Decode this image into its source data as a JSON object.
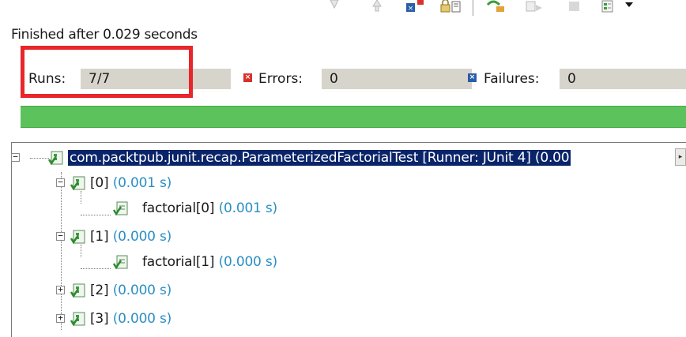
{
  "toolbar": {
    "icons": [
      "next-failure-icon",
      "previous-failure-icon",
      "show-failures-only-icon",
      "scroll-lock-icon",
      "rerun-test-icon",
      "rerun-failed-first-icon",
      "stop-icon",
      "history-icon",
      "view-menu-icon"
    ]
  },
  "status": {
    "text": "Finished after 0.029 seconds"
  },
  "counters": {
    "runs_label": "Runs:",
    "runs_value": "7/7",
    "errors_label": "Errors:",
    "errors_value": "0",
    "failures_label": "Failures:",
    "failures_value": "0"
  },
  "progress": {
    "fraction": 1.0,
    "color": "#5cc35c"
  },
  "tree": {
    "root": {
      "label": "com.packtpub.junit.recap.ParameterizedFactorialTest [Runner: JUnit 4] (0.00"
    },
    "nodes": [
      {
        "label": "[0]",
        "time": "(0.001 s)",
        "child": {
          "label": "factorial[0]",
          "time": "(0.001 s)"
        }
      },
      {
        "label": "[1]",
        "time": "(0.000 s)",
        "child": {
          "label": "factorial[1]",
          "time": "(0.000 s)"
        }
      },
      {
        "label": "[2]",
        "time": "(0.000 s)"
      },
      {
        "label": "[3]",
        "time": "(0.000 s)"
      }
    ]
  },
  "colors": {
    "highlight": "#e8262b",
    "selection": "#0a246a",
    "time": "#2b8fc4",
    "error": "#d9312b",
    "failure": "#2a5da8"
  }
}
